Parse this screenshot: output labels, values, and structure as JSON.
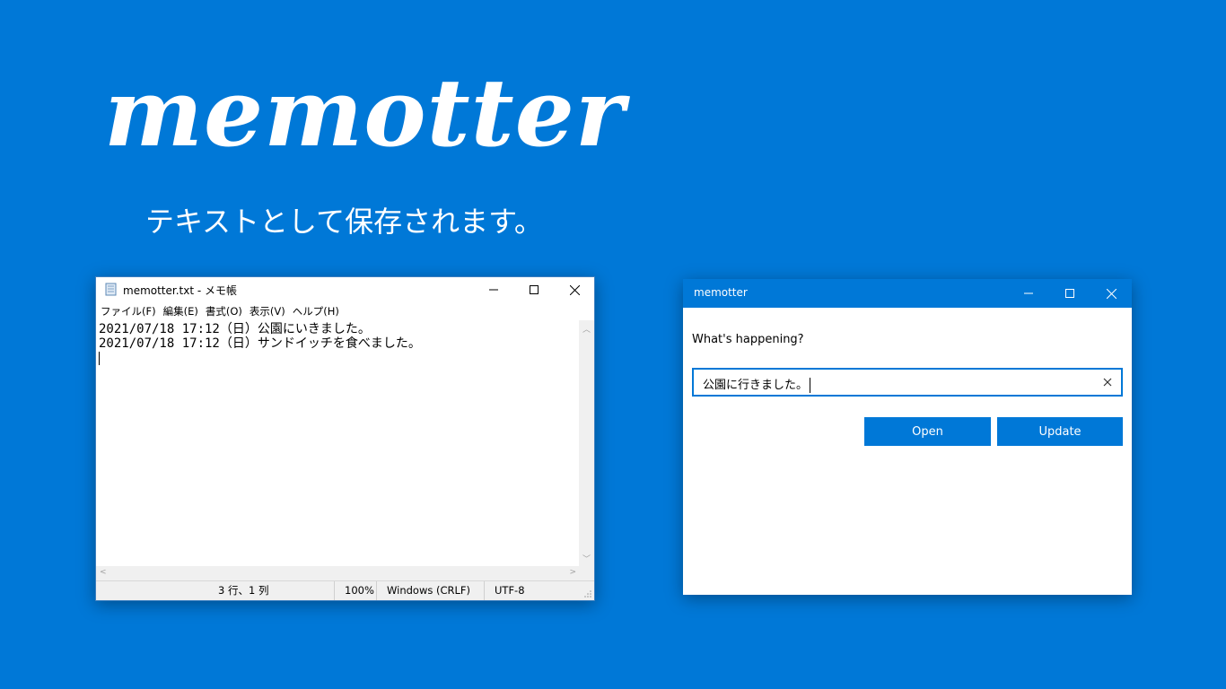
{
  "hero": {
    "logo_text": "memotter",
    "tagline": "テキストとして保存されます。"
  },
  "notepad": {
    "title": "memotter.txt - メモ帳",
    "menu": [
      "ファイル(F)",
      "編集(E)",
      "書式(O)",
      "表示(V)",
      "ヘルプ(H)"
    ],
    "lines": [
      "2021/07/18 17:12（日）公園にいきました。",
      "2021/07/18 17:12（日）サンドイッチを食べました。"
    ],
    "status": {
      "position": "3 行、1 列",
      "zoom": "100%",
      "line_ending": "Windows (CRLF)",
      "encoding": "UTF-8"
    }
  },
  "memotter_window": {
    "title": "memotter",
    "prompt": "What's happening?",
    "input_value": "公園に行きました。",
    "open_label": "Open",
    "update_label": "Update"
  },
  "colors": {
    "background": "#0078d7",
    "accent": "#0078d7"
  }
}
